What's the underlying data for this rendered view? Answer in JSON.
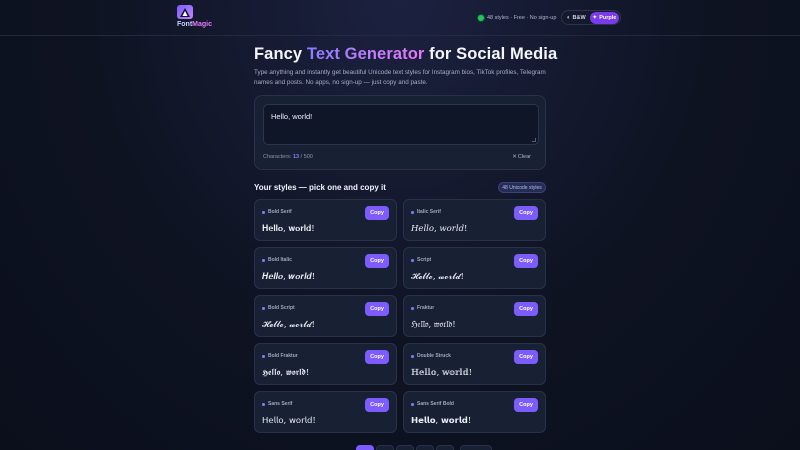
{
  "header": {
    "brand_prefix": "Font",
    "brand_suffix": "Magic",
    "logo_icon": "triangle-logo-icon",
    "stats_text": "48 styles · Free · No sign-up",
    "status_color": "#22c55e",
    "theme_bw_label": "B&W",
    "theme_purple_label": "Purple",
    "theme_bw_icon": "◐",
    "theme_purple_icon": "✦"
  },
  "hero": {
    "title_before": "Fancy ",
    "title_highlight": "Text Generator",
    "title_after": " for Social Media",
    "subtitle": "Type anything and instantly get beautiful Unicode text styles for Instagram bios, TikTok profiles, Telegram names and posts. No apps, no sign-up — just copy and paste."
  },
  "input": {
    "value": "Hello, world!",
    "counter_prefix": "Characters:",
    "count": "13",
    "separator": "/",
    "max": "500",
    "clear_label": "Clear",
    "clear_icon": "✕"
  },
  "styles": {
    "section_title": "Your styles — pick one and copy it",
    "count_badge": "48 Unicode styles",
    "copy_label": "Copy",
    "items": [
      {
        "label": "Bold Serif",
        "sample": "𝐇𝐞𝐥𝐥𝐨, 𝐰𝐨𝐫𝐥𝐝!"
      },
      {
        "label": "Italic Serif",
        "sample": "𝐻𝑒𝑙𝑙𝑜, 𝑤𝑜𝑟𝑙𝑑!"
      },
      {
        "label": "Bold Italic",
        "sample": "𝑯𝒆𝒍𝒍𝒐, 𝒘𝒐𝒓𝒍𝒅!"
      },
      {
        "label": "Script",
        "sample": "𝓗𝓮𝓵𝓵𝓸, 𝔀𝓸𝓻𝓵𝓭!"
      },
      {
        "label": "Bold Script",
        "sample": "𝓗𝓮𝓵𝓵𝓸, 𝔀𝓸𝓻𝓵𝓭!"
      },
      {
        "label": "Fraktur",
        "sample": "ℌ𝔢𝔩𝔩𝔬, 𝔴𝔬𝔯𝔩𝔡!"
      },
      {
        "label": "Bold Fraktur",
        "sample": "𝕳𝖊𝖑𝖑𝖔, 𝖜𝖔𝖗𝖑𝖉!"
      },
      {
        "label": "Double Struck",
        "sample": "ℍ𝕖𝕝𝕝𝕠, 𝕨𝕠𝕣𝕝𝕕!"
      },
      {
        "label": "Sans Serif",
        "sample": "𝖧𝖾𝗅𝗅𝗈, 𝗐𝗈𝗋𝗅𝖽!"
      },
      {
        "label": "Sans Serif Bold",
        "sample": "𝗛𝗲𝗹𝗹𝗼, 𝘄𝗼𝗿𝗹𝗱!"
      }
    ]
  },
  "colors": {
    "accent": "#7c5cff",
    "background": "#0e1322",
    "card": "#182033"
  }
}
